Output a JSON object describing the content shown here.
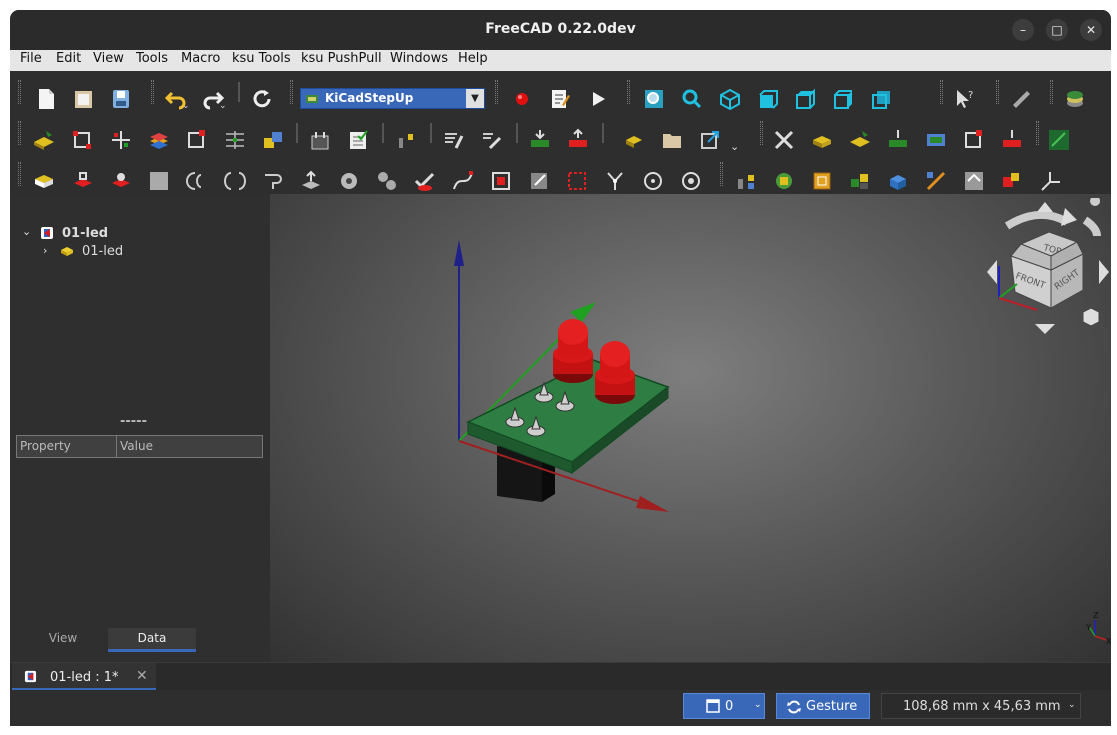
{
  "window": {
    "title": "FreeCAD 0.22.0dev"
  },
  "menu": {
    "items": [
      "File",
      "Edit",
      "View",
      "Tools",
      "Macro",
      "ksu Tools",
      "ksu PushPull",
      "Windows",
      "Help"
    ]
  },
  "toolbar": {
    "workbench": "KiCadStepUp"
  },
  "tree": {
    "root": "01-led",
    "child": "01-led"
  },
  "props": {
    "title": "-----",
    "col_property": "Property",
    "col_value": "Value"
  },
  "panel_tabs": [
    "View",
    "Data"
  ],
  "doc_tab": {
    "label": "01-led : 1*"
  },
  "status": {
    "pages": "0",
    "nav_mode": "Gesture",
    "dimensions": "108,68 mm x 45,63 mm"
  },
  "navcube": {
    "top": "TOP",
    "front": "FRONT",
    "right": "RIGHT"
  },
  "mini_axes": {
    "z": "Z",
    "y": "Y",
    "x": "X"
  },
  "colors": {
    "accent": "#3a68b8",
    "pcb": "#2e7d43",
    "led": "#d81818",
    "axis_x": "#b02020",
    "axis_y": "#20a020",
    "axis_z": "#2020a0"
  }
}
